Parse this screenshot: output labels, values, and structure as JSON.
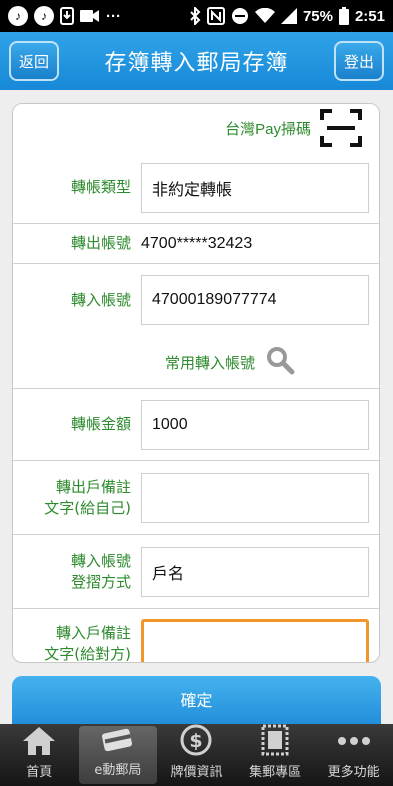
{
  "status_bar": {
    "battery": "75%",
    "time": "2:51"
  },
  "header": {
    "back_label": "返回",
    "title": "存簿轉入郵局存簿",
    "logout_label": "登出"
  },
  "form": {
    "taiwan_pay_label": "台灣Pay掃碼",
    "transfer_type": {
      "label": "轉帳類型",
      "value": "非約定轉帳"
    },
    "from_account": {
      "label": "轉出帳號",
      "value": "4700*****32423"
    },
    "to_account": {
      "label": "轉入帳號",
      "value": "47000189077774"
    },
    "favorites_label": "常用轉入帳號",
    "amount": {
      "label": "轉帳金額",
      "value": "1000"
    },
    "sender_note": {
      "label_line1": "轉出戶備註",
      "label_line2": "文字(給自己)",
      "value": ""
    },
    "passbook_method": {
      "label_line1": "轉入帳號",
      "label_line2": "登摺方式",
      "value": "戶名"
    },
    "receiver_note": {
      "label_line1": "轉入戶備註",
      "label_line2": "文字(給對方)",
      "value": ""
    }
  },
  "confirm_label": "確定",
  "tabs": [
    {
      "label": "首頁",
      "icon": "home-icon"
    },
    {
      "label": "e動郵局",
      "icon": "card-icon",
      "active": true
    },
    {
      "label": "牌價資訊",
      "icon": "dollar-icon"
    },
    {
      "label": "集郵專區",
      "icon": "stamp-icon"
    },
    {
      "label": "更多功能",
      "icon": "more-icon"
    }
  ],
  "colors": {
    "header_blue": "#1b8ad8",
    "label_green": "#2e8b2e",
    "active_field_border": "#f0962a"
  }
}
